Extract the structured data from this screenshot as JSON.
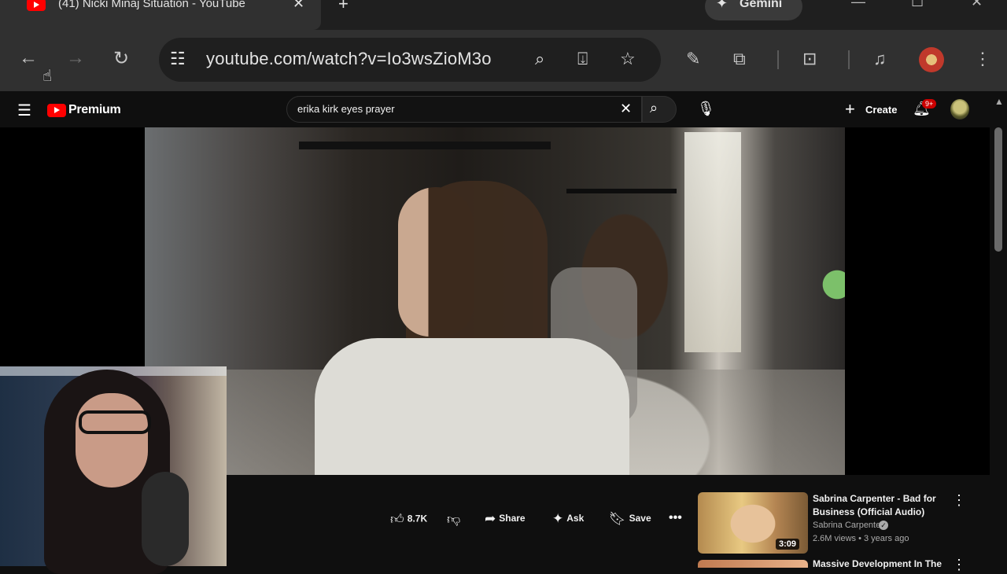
{
  "browser": {
    "tab_title": "(41) Nicki Minaj Situation - YouTube",
    "tab_close": "✕",
    "new_tab": "+",
    "gemini_label": "Gemini",
    "url": "youtube.com/watch?v=Io3wsZioM3o"
  },
  "youtube": {
    "brand": "Premium",
    "search_query": "erika kirk eyes prayer",
    "create_label": "Create",
    "notification_count": "9+"
  },
  "actions": {
    "like_count": "8.7K",
    "share_label": "Share",
    "ask_label": "Ask",
    "save_label": "Save"
  },
  "recommendations": [
    {
      "title": "Sabrina Carpenter - Bad for Business (Official Audio)",
      "channel": "Sabrina Carpenter",
      "meta": "2.6M views • 3 years ago",
      "duration": "3:09"
    },
    {
      "title": "Massive Development In The"
    }
  ],
  "colors": {
    "youtube_red": "#ff0000",
    "background": "#0f0f0f",
    "browser_chrome": "#303030"
  },
  "icons": [
    "back-icon",
    "forward-icon",
    "reload-icon",
    "site-settings-icon",
    "zoom-icon",
    "install-icon",
    "bookmark-star-icon",
    "menu-icon",
    "search-icon",
    "mic-icon",
    "bell-icon",
    "like-icon",
    "dislike-icon",
    "share-icon",
    "ask-icon",
    "save-icon",
    "more-icon"
  ]
}
